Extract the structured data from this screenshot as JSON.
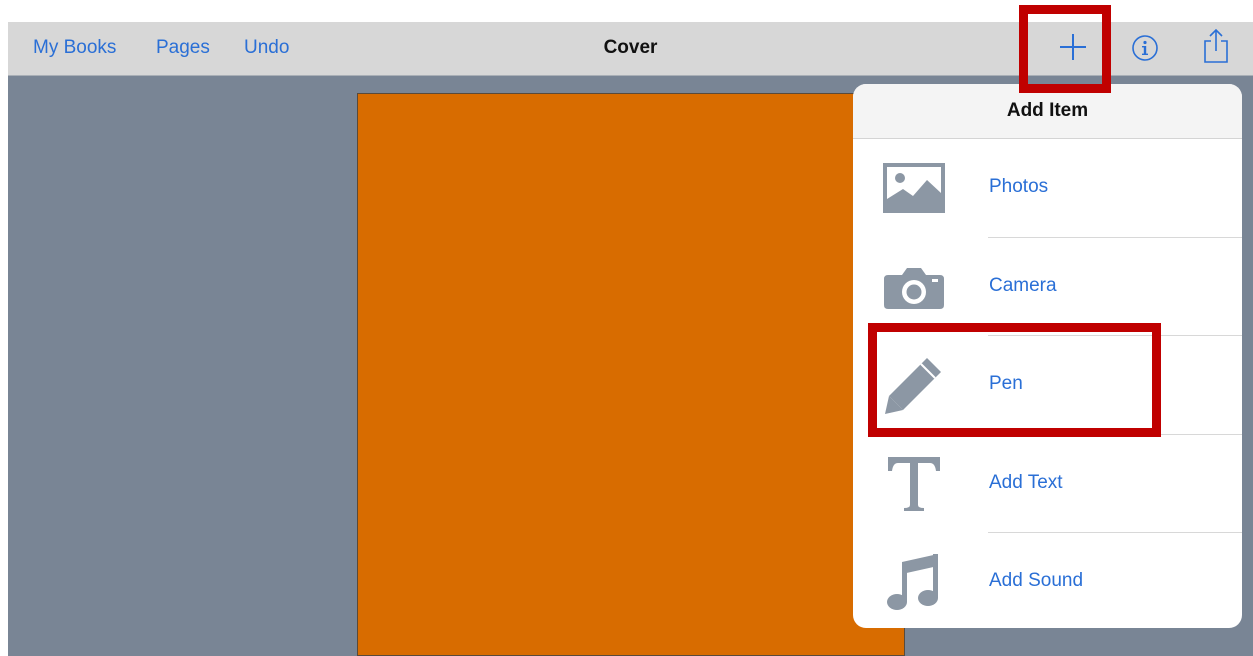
{
  "navbar": {
    "my_books": "My Books",
    "pages": "Pages",
    "undo": "Undo",
    "title": "Cover",
    "add_icon": "plus-icon",
    "info_icon": "info-icon",
    "share_icon": "share-icon"
  },
  "popover": {
    "title": "Add Item",
    "items": [
      {
        "label": "Photos",
        "icon": "photos-icon"
      },
      {
        "label": "Camera",
        "icon": "camera-icon"
      },
      {
        "label": "Pen",
        "icon": "pen-icon"
      },
      {
        "label": "Add Text",
        "icon": "text-icon"
      },
      {
        "label": "Add Sound",
        "icon": "music-note-icon"
      }
    ]
  },
  "colors": {
    "accent": "#2a6fd6",
    "background": "#798595",
    "cover_page": "#d86c00",
    "highlight": "#c00000",
    "icon_gray": "#8c97a4"
  }
}
